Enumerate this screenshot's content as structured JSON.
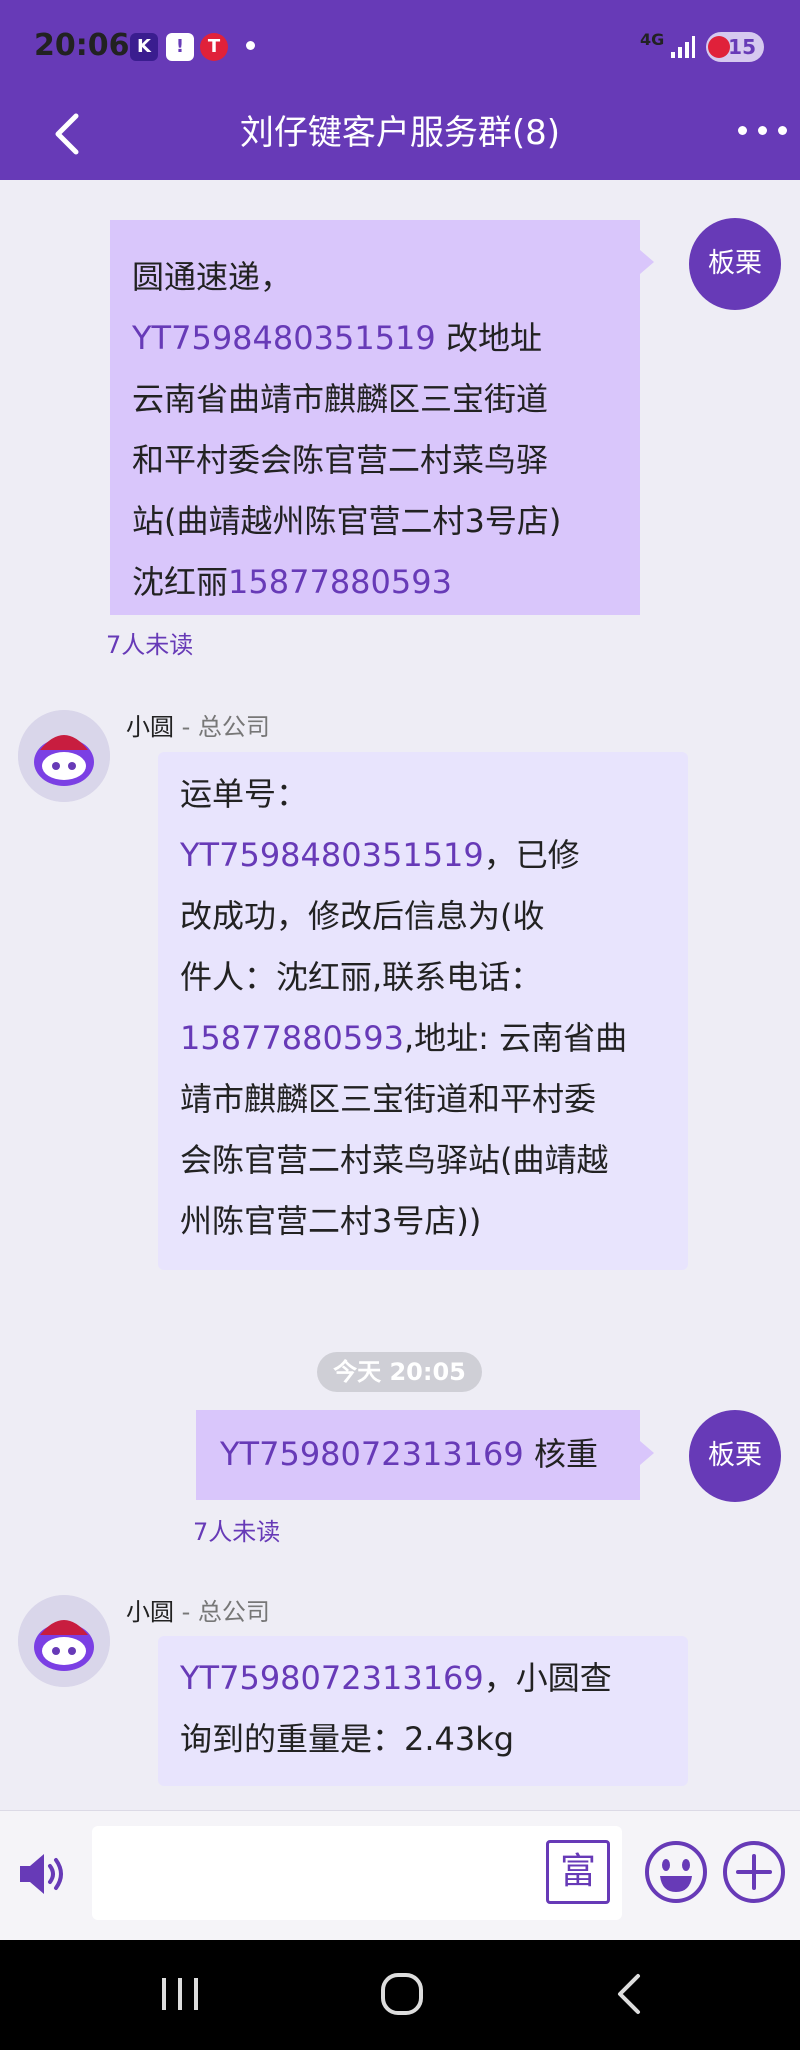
{
  "status_bar": {
    "time": "20:06",
    "app_icons": [
      "K",
      "!",
      "T"
    ],
    "network": "4G",
    "battery": "15"
  },
  "header": {
    "title": "刘仔键客户服务群(8)"
  },
  "messages": {
    "msg1": {
      "sender_avatar_label": "板栗",
      "line1": "圆通速递，",
      "tracking": "YT7598480351519",
      "after_tracking": "  改地址",
      "line3": "云南省曲靖市麒麟区三宝街道",
      "line4": "和平村委会陈官营二村菜鸟驿",
      "line5": "站(曲靖越州陈官营二村3号店)",
      "name": "沈红丽",
      "phone": "15877880593",
      "read_status": "7人未读"
    },
    "msg2": {
      "sender_name": "小圆",
      "sender_dept": " - 总公司",
      "line1": "运单号：",
      "tracking": "YT7598480351519",
      "after_tracking": "，已修",
      "line3": "改成功，修改后信息为(收",
      "line4": "件人：沈红丽,联系电话：",
      "phone": "15877880593",
      "after_phone": ",地址: 云南省曲",
      "line6": "靖市麒麟区三宝街道和平村委",
      "line7": "会陈官营二村菜鸟驿站(曲靖越",
      "line8": "州陈官营二村3号店))"
    },
    "timestamp": "今天 20:05",
    "msg3": {
      "sender_avatar_label": "板栗",
      "tracking": "YT7598072313169",
      "after_tracking": " 核重",
      "read_status": "7人未读"
    },
    "msg4": {
      "sender_name": "小圆",
      "sender_dept": " - 总公司",
      "tracking": "YT7598072313169",
      "after_tracking": "，小圆查",
      "line2": "询到的重量是：2.43kg"
    }
  },
  "input_bar": {
    "placeholder": "",
    "rich_text_label": "富"
  },
  "colors": {
    "brand": "#673ab7",
    "outgoing_bubble": "#d9c6fb",
    "incoming_bubble": "#e8e4fd",
    "background": "#eeedf5"
  }
}
